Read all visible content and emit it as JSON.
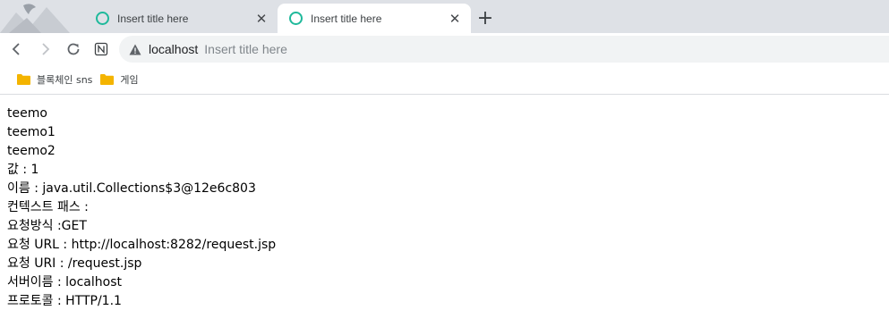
{
  "tabs": [
    {
      "title": "Insert title here",
      "active": false
    },
    {
      "title": "Insert title here",
      "active": true
    }
  ],
  "new_tab_symbol": "+",
  "close_symbol": "✕",
  "address_bar": {
    "host": "localhost",
    "page_title": "Insert title here"
  },
  "bookmarks": [
    {
      "label": "블록체인 sns"
    },
    {
      "label": "게임"
    }
  ],
  "content": {
    "lines": [
      "teemo",
      "teemo1",
      "teemo2",
      "값 : 1",
      "이름 : java.util.Collections$3@12e6c803",
      "컨텍스트 패스 :",
      "요청방식 :GET",
      "요청 URL : http://localhost:8282/request.jsp",
      "요청 URI : /request.jsp",
      "서버이름 : localhost",
      "프로토콜 : HTTP/1.1"
    ]
  },
  "colors": {
    "tab_icon": "#1fb99b",
    "folder": "#f4b400",
    "tabstrip": "#dee1e6"
  }
}
